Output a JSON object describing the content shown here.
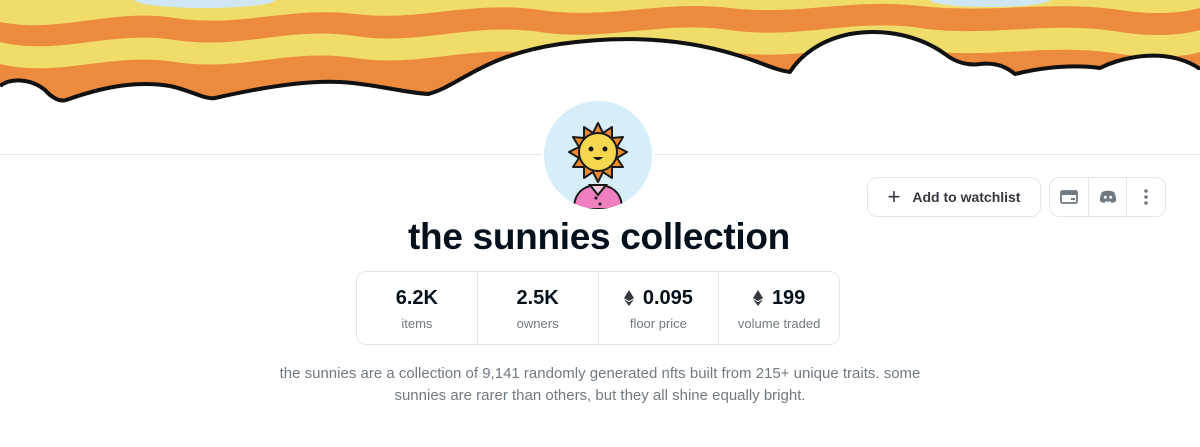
{
  "collection": {
    "name": "the sunnies collection",
    "description": "the sunnies are a collection of 9,141 randomly generated nfts built from 215+ unique traits. some sunnies are rarer than others, but they all shine equally bright."
  },
  "actions": {
    "watchlist_label": "Add to watchlist",
    "icons": [
      "website-icon",
      "discord-icon",
      "more-options-icon"
    ]
  },
  "stats": [
    {
      "value": "6.2K",
      "label": "items",
      "eth": false
    },
    {
      "value": "2.5K",
      "label": "owners",
      "eth": false
    },
    {
      "value": "0.095",
      "label": "floor price",
      "eth": true
    },
    {
      "value": "199",
      "label": "volume traded",
      "eth": true
    }
  ],
  "colors": {
    "banner_orange": "#ec8a3d",
    "banner_yellow": "#f0dc6a",
    "sky_blue": "#d6eef9",
    "text_primary": "#04111d",
    "text_secondary": "#707a83",
    "border": "#e5e8eb"
  }
}
